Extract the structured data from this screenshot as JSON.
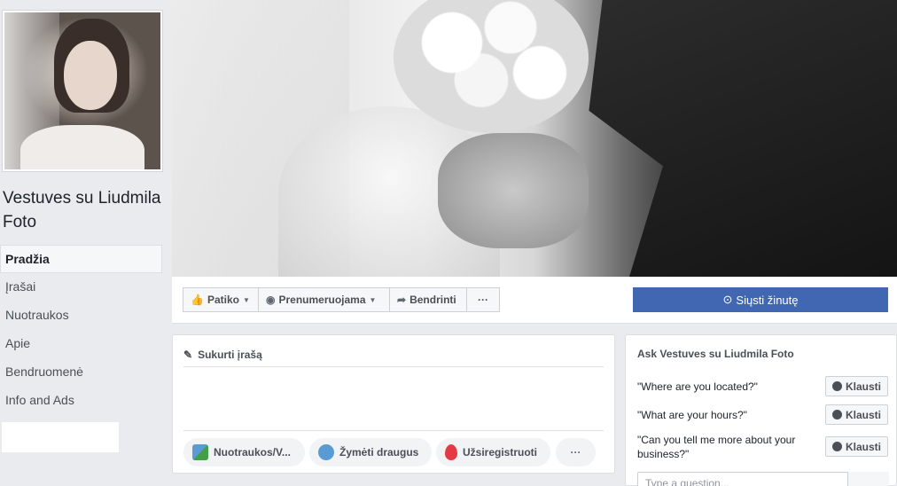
{
  "page": {
    "name": "Vestuves su Liudmila Foto"
  },
  "nav": {
    "items": [
      {
        "label": "Pradžia",
        "active": true
      },
      {
        "label": "Įrašai"
      },
      {
        "label": "Nuotraukos"
      },
      {
        "label": "Apie"
      },
      {
        "label": "Bendruomenė"
      },
      {
        "label": "Info and Ads"
      }
    ]
  },
  "actions": {
    "like": "Patiko",
    "follow": "Prenumeruojama",
    "share": "Bendrinti",
    "more": "···",
    "message": "Siųsti žinutę"
  },
  "composer": {
    "title": "Sukurti įrašą",
    "photo": "Nuotraukos/V...",
    "tag": "Žymėti draugus",
    "checkin": "Užsiregistruoti",
    "more": "···"
  },
  "ask": {
    "title": "Ask Vestuves su Liudmila Foto",
    "questions": [
      {
        "text": "\"Where are you located?\"",
        "button": "Klausti"
      },
      {
        "text": "\"What are your hours?\"",
        "button": "Klausti"
      },
      {
        "text": "\"Can you tell me more about your business?\"",
        "button": "Klausti"
      }
    ],
    "input_placeholder": "Type a question..."
  },
  "colors": {
    "accent": "#4267b2",
    "background": "#e9ebee"
  }
}
